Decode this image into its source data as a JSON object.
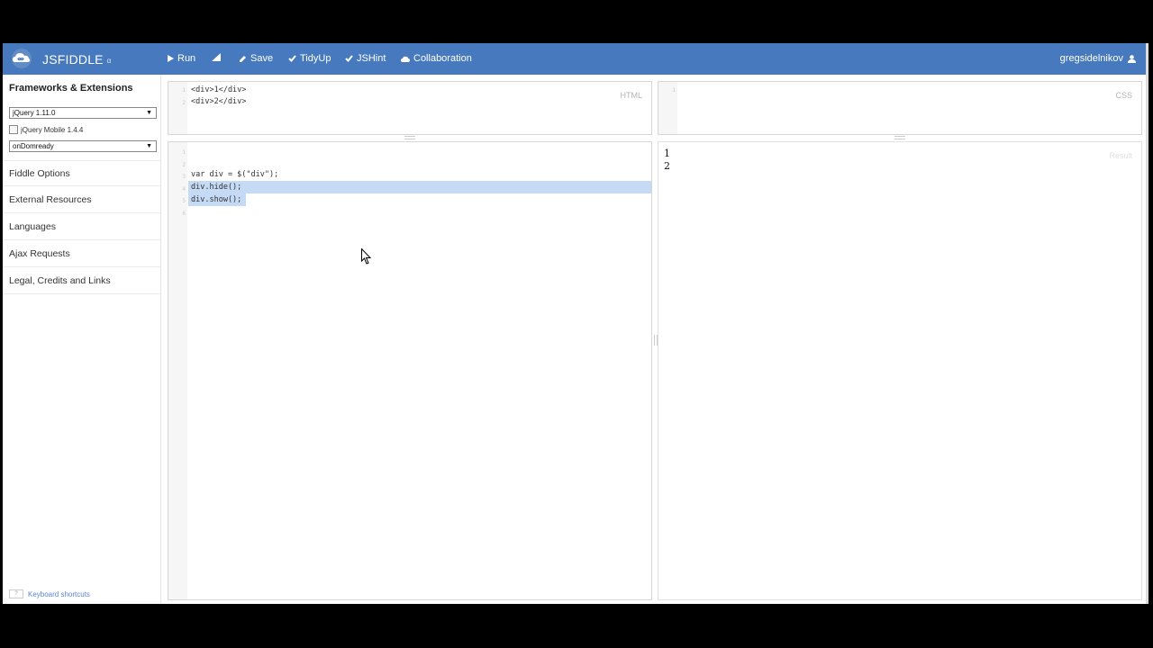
{
  "topbar": {
    "brand": "JSFIDDLE",
    "brand_sup": "α",
    "buttons": [
      {
        "label": "Run",
        "icon": "play-icon"
      },
      {
        "label": "",
        "icon": "signal-bars-icon"
      },
      {
        "label": "Save",
        "icon": "pencil-icon"
      },
      {
        "label": "TidyUp",
        "icon": "check-icon"
      },
      {
        "label": "JSHint",
        "icon": "check-icon"
      },
      {
        "label": "Collaboration",
        "icon": "cloud-icon"
      }
    ],
    "user": "gregsidelnikov"
  },
  "sidebar": {
    "title": "Frameworks & Extensions",
    "framework_select": "jQuery 1.11.0",
    "extension_label": "jQuery Mobile 1.4.4",
    "load_select": "onDomready",
    "items": [
      "Fiddle Options",
      "External Resources",
      "Languages",
      "Ajax Requests",
      "Legal, Credits and Links"
    ],
    "keyboard_shortcuts": "Keyboard shortcuts",
    "keyboard_key": "?"
  },
  "html_panel": {
    "label": "HTML",
    "lines": [
      "1",
      "2"
    ],
    "code": [
      "<div>1</div>",
      "<div>2</div>"
    ]
  },
  "css_panel": {
    "label": "CSS",
    "lines": [
      "1"
    ]
  },
  "js_panel": {
    "lines": [
      "1",
      "2",
      "3",
      "4",
      "5",
      "6"
    ],
    "code": [
      "",
      "",
      "var div = $(\"div\");",
      "div.hide();",
      "div.show();",
      ""
    ]
  },
  "result_panel": {
    "label": "Result",
    "lines": [
      "1",
      "2"
    ]
  },
  "colors": {
    "topbar": "#4679bd",
    "selection": "#c5daf4"
  }
}
